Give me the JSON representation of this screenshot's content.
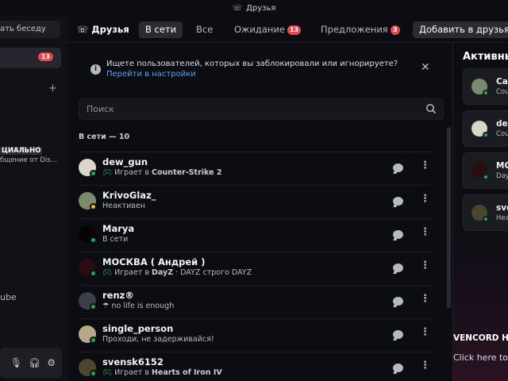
{
  "window": {
    "title": "Друзья"
  },
  "sidebar": {
    "find_conversation": "ать беседу",
    "friends_badge": "13",
    "item_official": "ЦИАЛЬНО",
    "item_official_sub": "бщение от Dis...",
    "item_youtube": "ube"
  },
  "header": {
    "friends_label": "Друзья",
    "tabs": [
      {
        "label": "В сети"
      },
      {
        "label": "Все"
      },
      {
        "label": "Ожидание",
        "count": "13"
      },
      {
        "label": "Предложения",
        "count": "3"
      }
    ],
    "add_friend": "Добавить в друзья"
  },
  "notice": {
    "question": "Ищете пользователей, которых вы заблокировали или игнорируете?",
    "link": "Перейти в настройки"
  },
  "search": {
    "placeholder": "Поиск"
  },
  "section_title": "В сети — 10",
  "friends": [
    {
      "name": "dew_gun",
      "prefix": "Играет в",
      "game": "Counter-Strike 2",
      "suffix": "",
      "status": "online",
      "avatar_color": "#d9d4cc",
      "icon": "gamepad-icon"
    },
    {
      "name": "KrivoGlaz_",
      "prefix": "Неактивен",
      "game": "",
      "suffix": "",
      "status": "idle",
      "avatar_color": "#7a8a6a",
      "icon": ""
    },
    {
      "name": "Marya",
      "prefix": "В сети",
      "game": "",
      "suffix": "",
      "status": "online",
      "avatar_color": "#050505",
      "icon": ""
    },
    {
      "name": "МОСКВА ( Андрей )",
      "prefix": "Играет в",
      "game": "DayZ",
      "suffix": " · DAYZ строго DAYZ",
      "status": "online",
      "avatar_color": "#2a0d10",
      "icon": "gamepad-icon"
    },
    {
      "name": "renz®",
      "prefix": "no life is enough",
      "game": "",
      "suffix": "",
      "status": "online",
      "avatar_color": "#3a3f4a",
      "icon": "custom-status-icon"
    },
    {
      "name": "single_person",
      "prefix": "Проходи, не задерживайся!",
      "game": "",
      "suffix": "",
      "status": "online",
      "avatar_color": "#b8a888",
      "icon": ""
    },
    {
      "name": "svensk6152",
      "prefix": "Играет в",
      "game": "Hearts of Iron IV",
      "suffix": "",
      "status": "online",
      "avatar_color": "#4a4630",
      "icon": "gamepad-icon"
    }
  ],
  "active_now": {
    "title": "Активные",
    "cards": [
      {
        "name": "Cay",
        "activity": "Cou",
        "avatar_color": "#7a8a6a"
      },
      {
        "name": "dew",
        "activity": "Cou",
        "avatar_color": "#d9d4cc"
      },
      {
        "name": "МО",
        "activity": "Day",
        "avatar_color": "#2a0d10"
      },
      {
        "name": "sve",
        "activity": "Hea",
        "avatar_color": "#4a4630"
      }
    ],
    "vencord_title": "VENCORD HA",
    "vencord_sub": "Click here to"
  },
  "colors": {
    "accent_link": "#4ea4f6",
    "badge": "#e5484d",
    "online": "#23a55a",
    "idle": "#f0b232"
  }
}
